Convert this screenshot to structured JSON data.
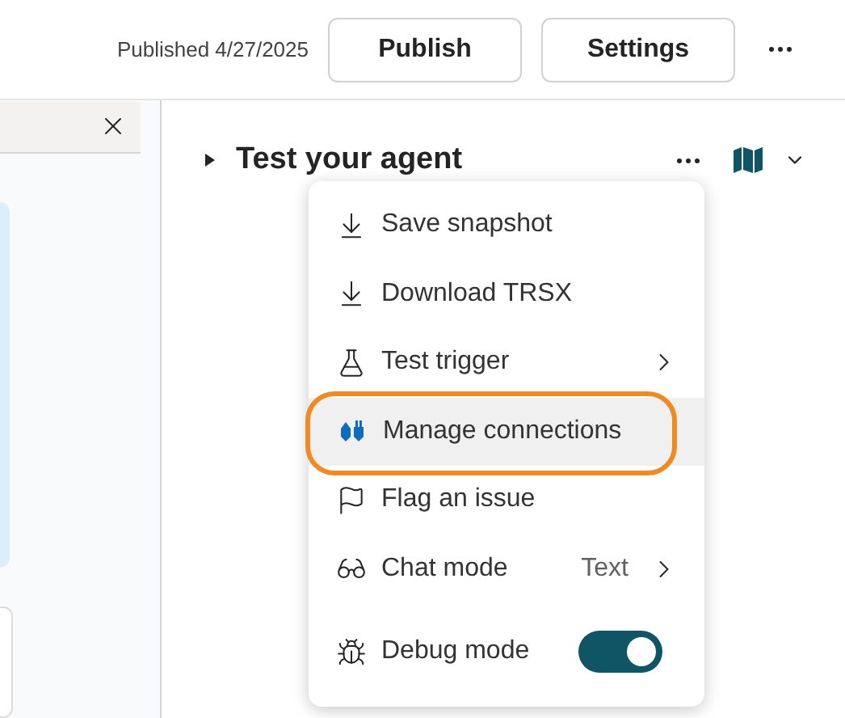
{
  "header": {
    "published": "Published 4/27/2025",
    "buttons": [
      "Publish",
      "Settings"
    ]
  },
  "test_panel": {
    "title": "Test your agent",
    "expanded": false
  },
  "menu": {
    "items": [
      {
        "kind": "action",
        "label": "Save snapshot",
        "selected": false,
        "annotated": false
      },
      {
        "kind": "action",
        "label": "Download TRSX",
        "selected": false,
        "annotated": false
      },
      {
        "kind": "submenu",
        "label": "Test trigger",
        "selected": false,
        "annotated": false
      },
      {
        "kind": "action",
        "label": "Manage connections",
        "selected": true,
        "annotated": true
      },
      {
        "kind": "action",
        "label": "Flag an issue",
        "selected": false,
        "annotated": false
      },
      {
        "kind": "submenu",
        "label": "Chat mode",
        "value": "Text",
        "selected": false,
        "annotated": false
      },
      {
        "kind": "toggle",
        "label": "Debug mode",
        "on": true,
        "selected": false,
        "annotated": false
      }
    ]
  }
}
